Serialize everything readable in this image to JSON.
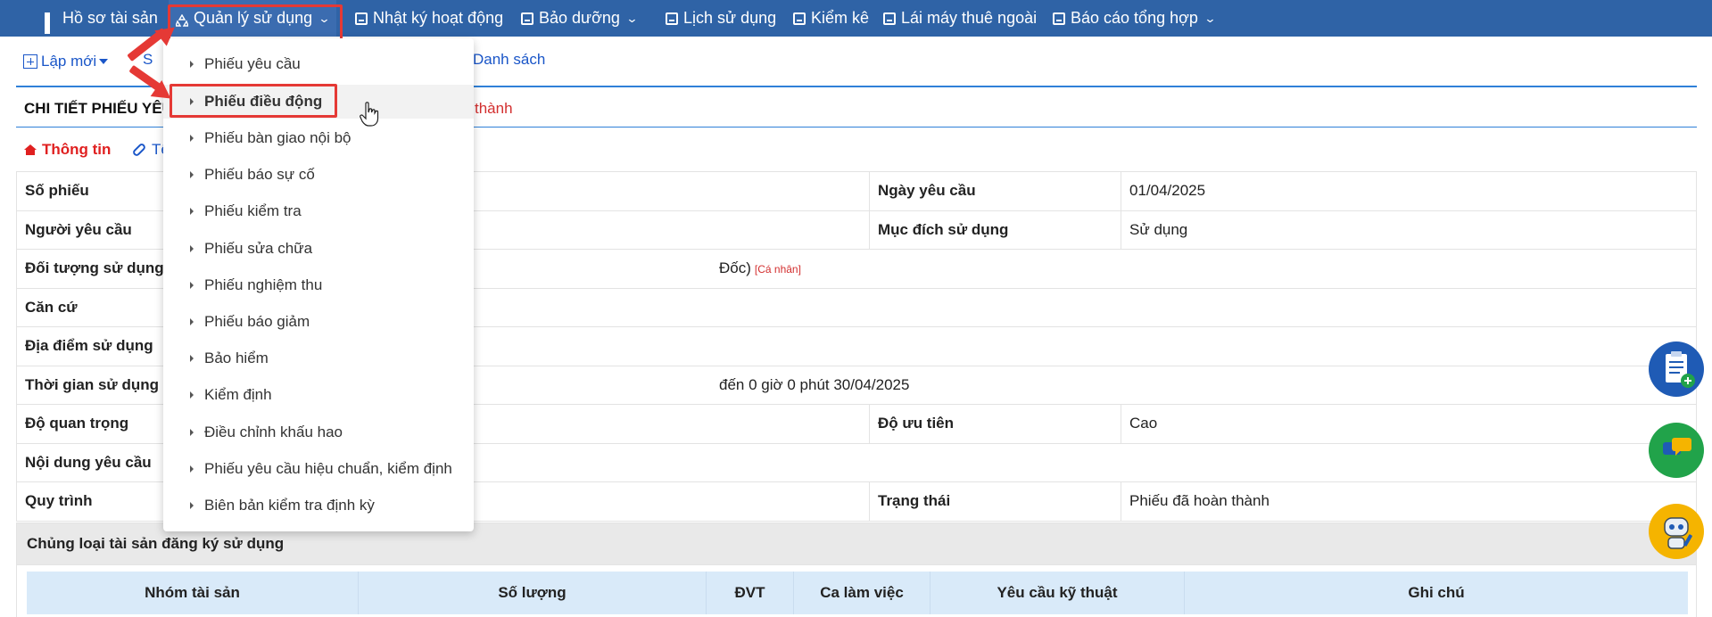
{
  "topnav": {
    "items": [
      {
        "label": "Hồ sơ tài sản",
        "icon": "grid-icon",
        "dropdown": false
      },
      {
        "label": "Quản lý sử dụng",
        "icon": "recycle-icon",
        "dropdown": true
      },
      {
        "label": "Nhật ký hoạt động",
        "icon": "save-icon",
        "dropdown": false
      },
      {
        "label": "Bảo dưỡng",
        "icon": "maintenance-icon",
        "dropdown": true
      },
      {
        "label": "Lịch sử dụng",
        "icon": "calendar-icon",
        "dropdown": false
      },
      {
        "label": "Kiểm kê",
        "icon": "inventory-icon",
        "dropdown": false
      },
      {
        "label": "Lái máy thuê ngoài",
        "icon": "id-card-icon",
        "dropdown": false
      },
      {
        "label": "Báo cáo tổng hợp",
        "icon": "monitor-icon",
        "dropdown": true
      }
    ],
    "bg_color": "#2f63a6"
  },
  "toolbar": {
    "new_label": "Lập mới",
    "second_prefix": "S",
    "list_label": "Danh sách"
  },
  "section": {
    "title_visible": "CHI TIẾT PHIẾU YÊU",
    "status_visible": "thành"
  },
  "tabs": {
    "info": "Thông tin",
    "link_visible": "Tệ"
  },
  "detail": {
    "rows": [
      {
        "label": "Số phiếu",
        "value": "",
        "label2": "Ngày yêu cầu",
        "value2": "01/04/2025"
      },
      {
        "label": "Người yêu cầu",
        "value": "",
        "label2": "Mục đích sử dụng",
        "value2": "Sử dụng"
      },
      {
        "label": "Đối tượng sử dụng",
        "value": "Đốc)",
        "tag": "[Cá nhân]"
      },
      {
        "label": "Căn cứ",
        "value": ""
      },
      {
        "label": "Địa điểm sử dụng",
        "value": ""
      },
      {
        "label": "Thời gian sử dụng",
        "value": "đến 0 giờ 0 phút 30/04/2025"
      },
      {
        "label": "Độ quan trọng",
        "value": "",
        "label2": "Độ ưu tiên",
        "value2": "Cao"
      },
      {
        "label": "Nội dung yêu cầu",
        "value": ""
      },
      {
        "label": "Quy trình",
        "value": "",
        "label2": "Trạng thái",
        "value2": "Phiếu đã hoàn thành"
      }
    ]
  },
  "asset_group": {
    "title": "Chủng loại tài sản đăng ký sử dụng",
    "columns": [
      "Nhóm tài sản",
      "Số lượng",
      "ĐVT",
      "Ca làm việc",
      "Yêu cầu kỹ thuật",
      "Ghi chú"
    ]
  },
  "dropdown": {
    "items": [
      {
        "label": "Phiếu yêu cầu",
        "active": false
      },
      {
        "label": "Phiếu điều động",
        "active": true
      },
      {
        "label": "Phiếu bàn giao nội bộ",
        "active": false
      },
      {
        "label": "Phiếu báo sự cố",
        "active": false
      },
      {
        "label": "Phiếu kiểm tra",
        "active": false
      },
      {
        "label": "Phiếu sửa chữa",
        "active": false
      },
      {
        "label": "Phiếu nghiệm thu",
        "active": false
      },
      {
        "label": "Phiếu báo giảm",
        "active": false
      },
      {
        "label": "Bảo hiểm",
        "active": false
      },
      {
        "label": "Kiểm định",
        "active": false
      },
      {
        "label": "Điều chỉnh khấu hao",
        "active": false
      },
      {
        "label": "Phiếu yêu cầu hiệu chuẩn, kiểm định",
        "active": false
      },
      {
        "label": "Biên bản kiểm tra định kỳ",
        "active": false
      }
    ]
  },
  "floating_buttons": [
    {
      "icon": "clipboard-add-icon",
      "color": "#1f5bb5"
    },
    {
      "icon": "chat-icon",
      "color": "#21a34a"
    },
    {
      "icon": "robot-support-icon",
      "color": "#f5b400"
    }
  ],
  "annotation_color": "#e53935"
}
